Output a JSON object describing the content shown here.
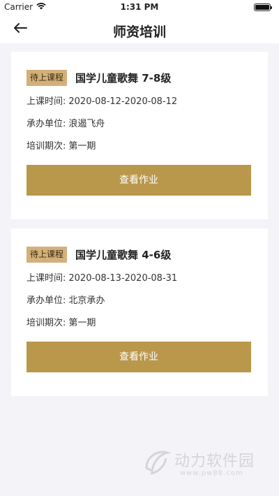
{
  "status_bar": {
    "carrier": "Carrier",
    "time": "1:31 PM",
    "battery_level": 1.0
  },
  "nav": {
    "title": "师资培训",
    "back_icon": "arrow-left-icon"
  },
  "courses": [
    {
      "badge": "待上课程",
      "title": "国学儿童歌舞 7-8级",
      "time_label": "上课时间:",
      "time_value": "2020-08-12-2020-08-12",
      "org_label": "承办单位:",
      "org_value": "浪遏飞舟",
      "period_label": "培训期次:",
      "period_value": "第一期",
      "button_label": "查看作业"
    },
    {
      "badge": "待上课程",
      "title": "国学儿童歌舞 4-6级",
      "time_label": "上课时间:",
      "time_value": "2020-08-13-2020-08-31",
      "org_label": "承办单位:",
      "org_value": "北京承办",
      "period_label": "培训期次:",
      "period_value": "第一期",
      "button_label": "查看作业"
    }
  ],
  "watermark": {
    "text": "动力软件园",
    "url": "www.pw88.com"
  },
  "colors": {
    "badge_bg": "#d3b07a",
    "button_bg": "#b9974b",
    "page_bg": "#f3f3f8"
  }
}
